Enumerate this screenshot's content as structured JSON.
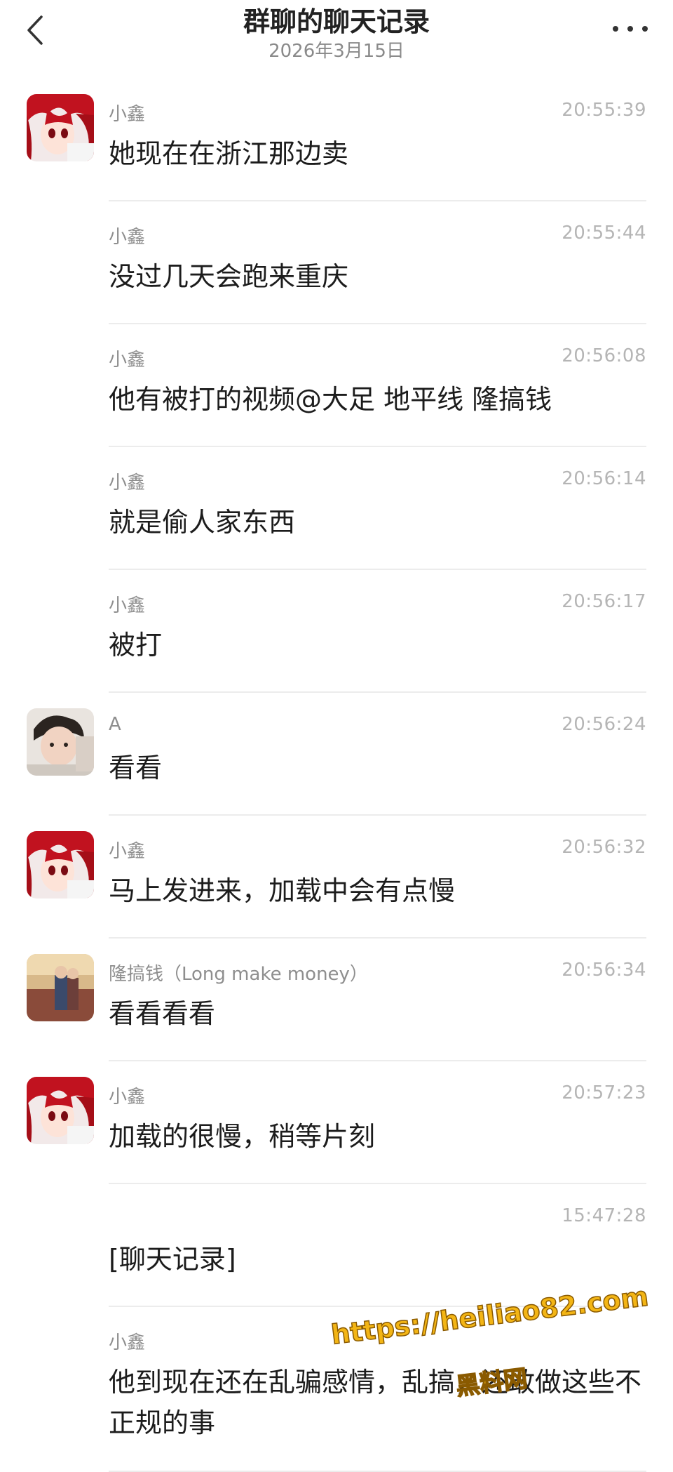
{
  "header": {
    "title": "群聊的聊天记录",
    "date": "2026年3月15日"
  },
  "messages": [
    {
      "sender": "小鑫",
      "time": "20:55:39",
      "text": "她现在在浙江那边卖",
      "avatar": "red-hair-anime-avatar"
    },
    {
      "sender": "小鑫",
      "time": "20:55:44",
      "text": "没过几天会跑来重庆",
      "avatar": ""
    },
    {
      "sender": "小鑫",
      "time": "20:56:08",
      "text": "他有被打的视频@大足  地平线 隆搞钱",
      "avatar": ""
    },
    {
      "sender": "小鑫",
      "time": "20:56:14",
      "text": "就是偷人家东西",
      "avatar": ""
    },
    {
      "sender": "小鑫",
      "time": "20:56:17",
      "text": "被打",
      "avatar": ""
    },
    {
      "sender": "A",
      "time": "20:56:24",
      "text": "看看",
      "avatar": "boy-photo-avatar"
    },
    {
      "sender": "小鑫",
      "time": "20:56:32",
      "text": "马上发进来，加载中会有点慢",
      "avatar": "red-hair-anime-avatar"
    },
    {
      "sender": "隆搞钱（Long make money）",
      "time": "20:56:34",
      "text": "看看看看",
      "avatar": "couple-photo-avatar"
    },
    {
      "sender": "小鑫",
      "time": "20:57:23",
      "text": "加载的很慢，稍等片刻",
      "avatar": "red-hair-anime-avatar"
    },
    {
      "sender": "",
      "time": "15:47:28",
      "text": "[聊天记录]",
      "avatar": ""
    },
    {
      "sender": "小鑫",
      "time": "",
      "text": "他到现在还在乱骗感情，乱搞，还敢做这些不正规的事",
      "avatar": ""
    }
  ],
  "watermark": {
    "url": "https://heiliao82.com",
    "name": "黑料网"
  },
  "colors": {
    "background": "#ffffff",
    "sender": "#8e8e8e",
    "time": "#b5b5b5",
    "divider": "#ececec",
    "watermark": "#f3b515"
  }
}
